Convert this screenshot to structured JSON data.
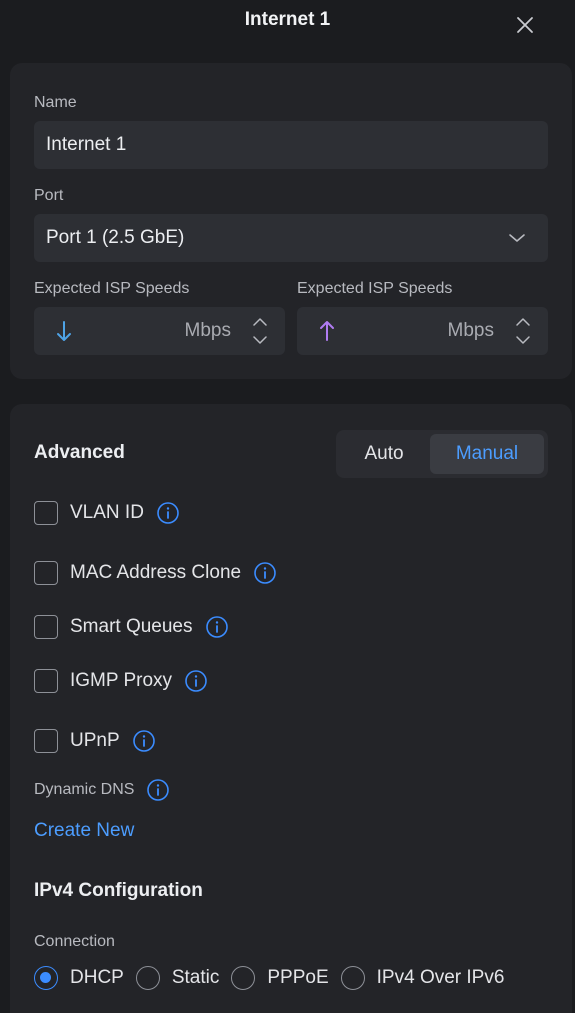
{
  "header": {
    "title": "Internet 1"
  },
  "name_field": {
    "label": "Name",
    "value": "Internet 1"
  },
  "port_field": {
    "label": "Port",
    "value": "Port 1 (2.5 GbE)"
  },
  "speeds": {
    "download": {
      "label": "Expected ISP Speeds",
      "unit": "Mbps",
      "icon": "arrow-down-icon"
    },
    "upload": {
      "label": "Expected ISP Speeds",
      "unit": "Mbps",
      "icon": "arrow-up-icon"
    }
  },
  "advanced": {
    "title": "Advanced",
    "modes": {
      "auto": "Auto",
      "manual": "Manual",
      "selected": "Manual"
    },
    "options": [
      {
        "label": "VLAN ID",
        "checked": false
      },
      {
        "label": "MAC Address Clone",
        "checked": false
      },
      {
        "label": "Smart Queues",
        "checked": false
      },
      {
        "label": "IGMP Proxy",
        "checked": false
      },
      {
        "label": "UPnP",
        "checked": false
      }
    ],
    "dynamic_dns": {
      "label": "Dynamic DNS",
      "link": "Create New"
    }
  },
  "ipv4": {
    "title": "IPv4 Configuration",
    "connection_label": "Connection",
    "options": [
      "DHCP",
      "Static",
      "PPPoE",
      "IPv4 Over IPv6"
    ],
    "selected": "DHCP"
  },
  "colors": {
    "background": "#1b1c1f",
    "card": "#232428",
    "field": "#2d2f34",
    "accent": "#4c9dff",
    "download_arrow": "#4ea3e6",
    "upload_arrow": "#b07cf2"
  }
}
